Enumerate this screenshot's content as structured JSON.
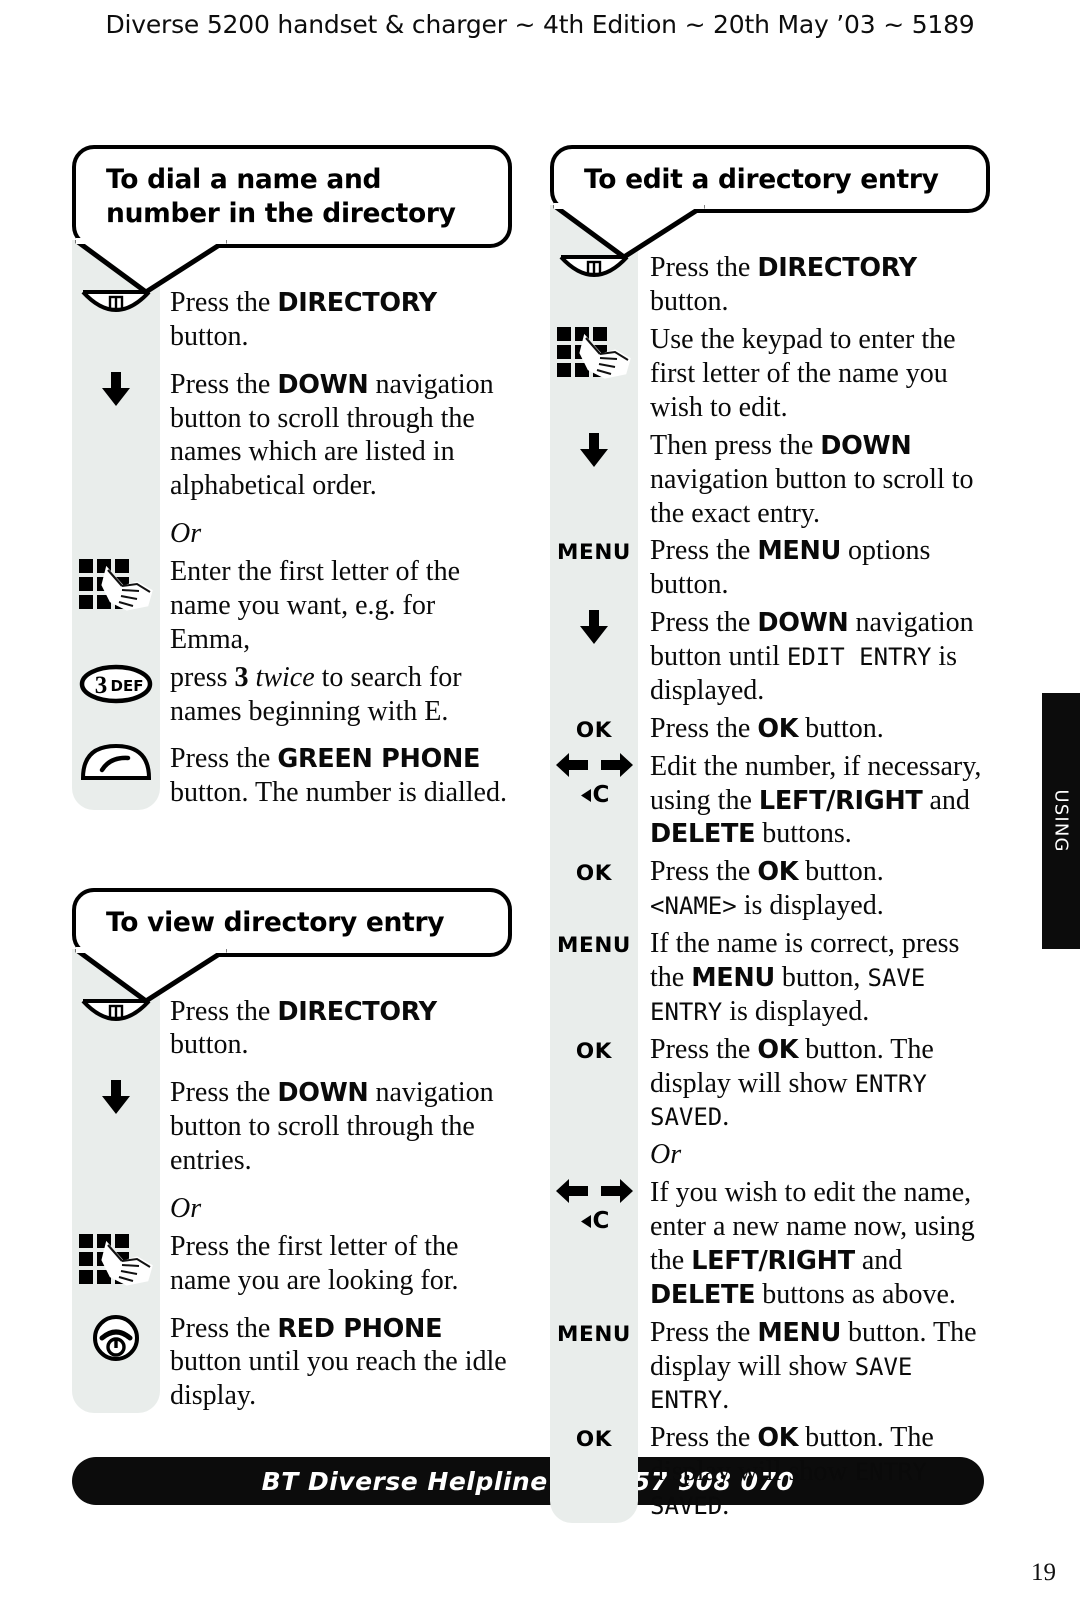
{
  "header": {
    "running_head": "Diverse 5200 handset & charger ~ 4th Edition ~ 20th May ’03 ~ 5189"
  },
  "side_tab": {
    "label": "USING"
  },
  "footer": {
    "helpline": "BT Diverse Helpline – 08457 908 070",
    "page_number": "19"
  },
  "sections": [
    {
      "id": "dial-name-number",
      "title": "To dial a name and number in the directory",
      "steps": [
        {
          "icon": "directory-button-icon",
          "text_html": "Press the <b>DIRECTORY</b> button."
        },
        {
          "icon": "down-arrow-icon",
          "text_html": "Press the <b>DOWN</b> navigation button to scroll through the names which are listed in alphabetical order."
        },
        {
          "icon": "none",
          "text_html": "<i>Or</i>"
        },
        {
          "icon": "keypad-hand-icon",
          "text_html": "Enter the first letter of the name you want, e.g. for Emma,"
        },
        {
          "icon": "key-3-def-icon",
          "text_html": "press <span class=\"bnum\">3</span> <i>twice</i> to search for names beginning with E."
        },
        {
          "icon": "green-phone-icon",
          "text_html": "Press the <b>GREEN PHONE</b> button. The number is dialled."
        }
      ]
    },
    {
      "id": "view-directory-entry",
      "title": "To view directory entry",
      "steps": [
        {
          "icon": "directory-button-icon",
          "text_html": "Press the <b>DIRECTORY</b> button."
        },
        {
          "icon": "down-arrow-icon",
          "text_html": "Press the <b>DOWN</b> navigation button to scroll through the entries."
        },
        {
          "icon": "none",
          "text_html": "<i>Or</i>"
        },
        {
          "icon": "keypad-hand-icon",
          "text_html": "Press the first letter of the name you are looking for."
        },
        {
          "icon": "red-phone-icon",
          "text_html": "Press the <b>RED PHONE</b> button until you reach the idle display."
        }
      ]
    },
    {
      "id": "edit-directory-entry",
      "title": "To edit a directory entry",
      "steps": [
        {
          "icon": "directory-button-icon",
          "text_html": "Press the <b>DIRECTORY</b> button."
        },
        {
          "icon": "keypad-hand-icon",
          "text_html": "Use the keypad to enter the first letter of the name you wish to edit."
        },
        {
          "icon": "down-arrow-icon",
          "text_html": "Then press the <b>DOWN</b> navigation button to scroll to the exact entry."
        },
        {
          "icon": "menu-key-label",
          "text_html": "Press the <b>MENU</b> options button."
        },
        {
          "icon": "down-arrow-icon",
          "text_html": "Press the <b>DOWN</b> navigation button until <span class=\"lcd\">EDIT ENTRY</span> is displayed."
        },
        {
          "icon": "ok-key-label",
          "text_html": "Press the <b>OK</b> button."
        },
        {
          "icon": "left-right-delete-icon",
          "text_html": "Edit the number, if necessary, using the <b>LEFT/RIGHT</b> and <b>DELETE</b> buttons."
        },
        {
          "icon": "ok-key-label",
          "text_html": "Press the <b>OK</b> button. <span class=\"lcd\">&lt;NAME&gt;</span> is displayed."
        },
        {
          "icon": "menu-key-label",
          "text_html": "If the name is correct, press the <b>MENU</b> button, <span class=\"lcd\">SAVE ENTRY</span> is displayed."
        },
        {
          "icon": "ok-key-label",
          "text_html": "Press the <b>OK</b> button. The display will show <span class=\"lcd\">ENTRY SAVED</span>."
        },
        {
          "icon": "none",
          "text_html": "<i>Or</i>"
        },
        {
          "icon": "left-right-delete-icon",
          "text_html": "If you wish to edit the name, enter a new name now, using the <b>LEFT/RIGHT</b> and <b>DELETE</b> buttons as above."
        },
        {
          "icon": "menu-key-label",
          "text_html": "Press the <b>MENU</b> button. The display will show <span class=\"lcd\">SAVE ENTRY</span>."
        },
        {
          "icon": "ok-key-label",
          "text_html": "Press the <b>OK</b> button. The display will show <span class=\"lcd\">ENTRY SAVED</span>."
        }
      ]
    }
  ],
  "key_labels": {
    "menu": "MENU",
    "ok": "OK",
    "delete": "C",
    "key_3_digit": "3",
    "key_3_letters": "DEF"
  },
  "colors": {
    "strip_grey": "#e9edeb",
    "ink": "#000000",
    "bar_black": "#0c0c0c"
  }
}
